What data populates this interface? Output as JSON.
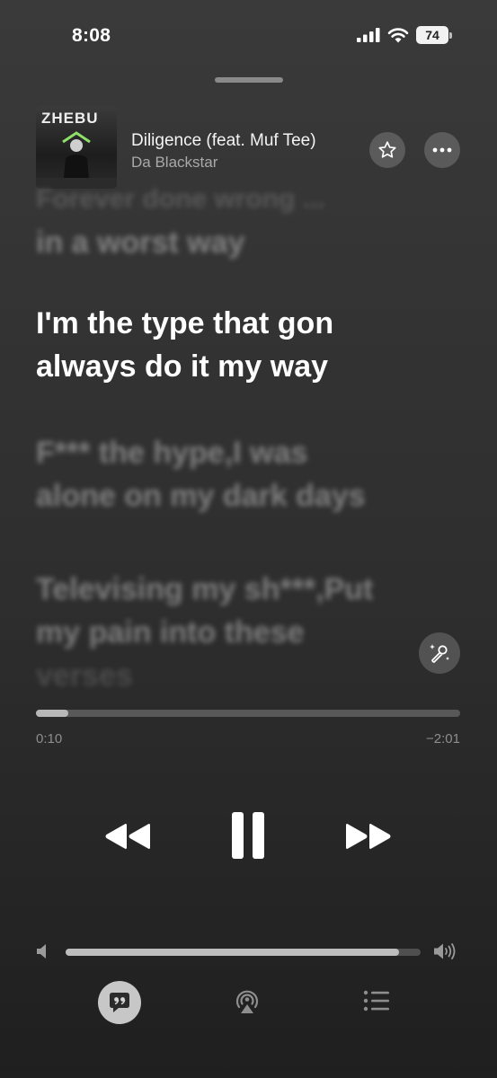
{
  "status": {
    "time": "8:08",
    "battery": "74"
  },
  "now_playing": {
    "artwork_text": "ZHEBU",
    "title": "Diligence (feat. Muf Tee)",
    "artist": "Da Blackstar"
  },
  "lyrics": {
    "faded_top": "Forever done wrong ...",
    "previous": "in a worst way",
    "current_line1": "I'm the type that gon",
    "current_line2": "always do it my way",
    "next_line1": "F*** the hype,I was",
    "next_line2": "alone on my dark days",
    "after_line1": "Televising my sh***,Put",
    "after_line2": "my pain into these",
    "after_line3": "verses"
  },
  "playback": {
    "elapsed": "0:10",
    "remaining": "−2:01",
    "progress_fraction": 0.076,
    "volume_fraction": 0.94,
    "state": "playing"
  },
  "icons": {
    "star": "star-icon",
    "more": "ellipsis-icon",
    "sing": "microphone-sparkle-icon",
    "rewind": "rewind-icon",
    "pause": "pause-icon",
    "forward": "fast-forward-icon",
    "lyrics": "quote-bubble-icon",
    "airplay": "airplay-audio-icon",
    "queue": "list-icon"
  }
}
